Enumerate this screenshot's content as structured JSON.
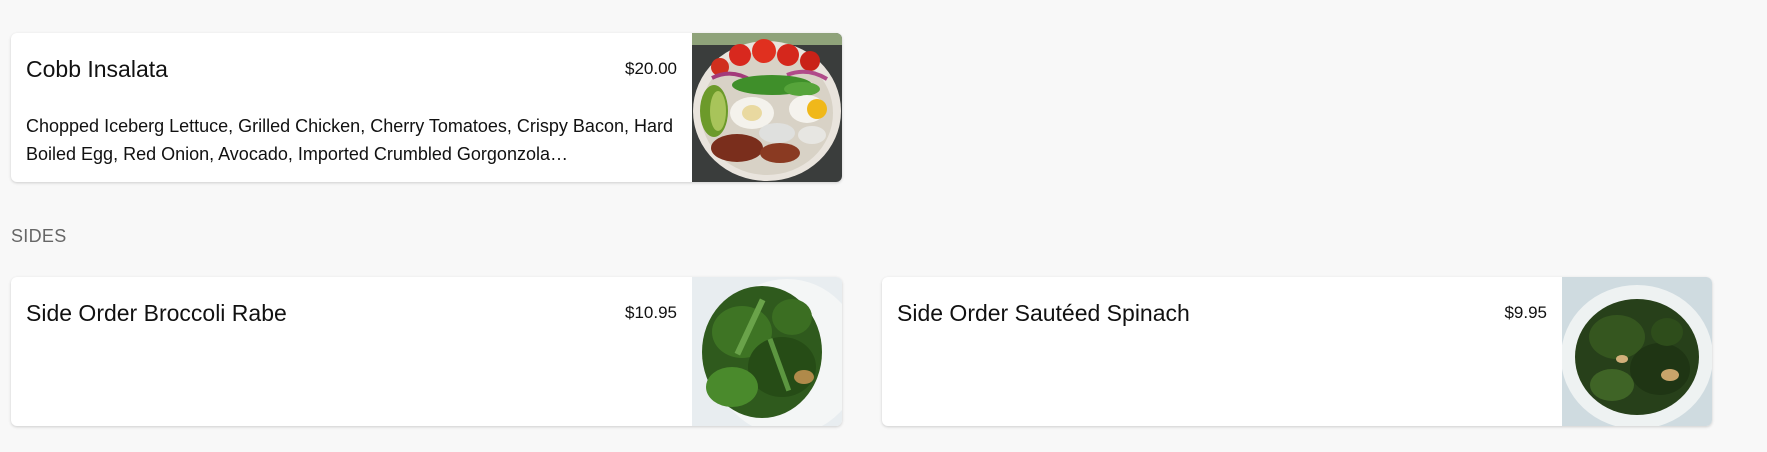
{
  "menu": {
    "items_top": [
      {
        "name": "Cobb Insalata",
        "price": "$20.00",
        "description": "Chopped Iceberg Lettuce, Grilled Chicken, Cherry Tomatoes, Crispy Bacon, Hard Boiled Egg, Red Onion, Avocado, Imported Crumbled Gorgonzola…",
        "image_icon": "cobb-salad-photo"
      }
    ],
    "sections": [
      {
        "heading": "SIDES",
        "items": [
          {
            "name": "Side Order Broccoli Rabe",
            "price": "$10.95",
            "image_icon": "broccoli-rabe-photo"
          },
          {
            "name": "Side Order Sautéed Spinach",
            "price": "$9.95",
            "image_icon": "sauteed-spinach-photo"
          }
        ]
      }
    ]
  }
}
